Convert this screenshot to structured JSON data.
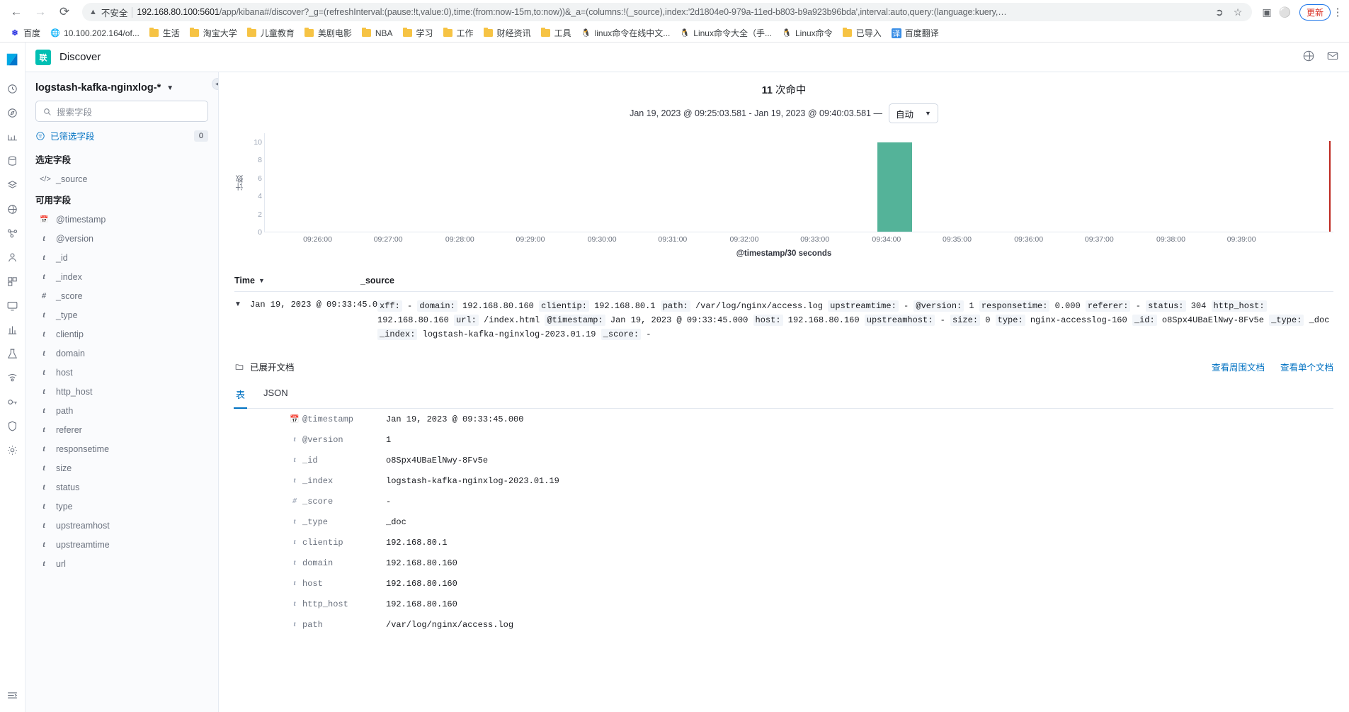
{
  "browser": {
    "back_icon": "back-arrow-icon",
    "forward_icon": "forward-arrow-icon",
    "reload_icon": "reload-icon",
    "not_secure_label": "不安全",
    "url_host": "192.168.80.100:5601",
    "url_rest": "/app/kibana#/discover?_g=(refreshInterval:(pause:!t,value:0),time:(from:now-15m,to:now))&_a=(columns:!(_source),index:'2d1804e0-979a-11ed-b803-b9a923b96bda',interval:auto,query:(language:kuery,…",
    "update_label": "更新",
    "bookmarks": [
      {
        "label": "百度",
        "icon": "baidu-icon"
      },
      {
        "label": "10.100.202.164/of...",
        "icon": "globe-icon"
      },
      {
        "label": "生活",
        "icon": "folder-icon"
      },
      {
        "label": "淘宝大学",
        "icon": "folder-icon"
      },
      {
        "label": "儿童教育",
        "icon": "folder-icon"
      },
      {
        "label": "美剧电影",
        "icon": "folder-icon"
      },
      {
        "label": "NBA",
        "icon": "folder-icon"
      },
      {
        "label": "学习",
        "icon": "folder-icon"
      },
      {
        "label": "工作",
        "icon": "folder-icon"
      },
      {
        "label": "财经资讯",
        "icon": "folder-icon"
      },
      {
        "label": "工具",
        "icon": "folder-icon"
      },
      {
        "label": "linux命令在线中文...",
        "icon": "tux-icon"
      },
      {
        "label": "Linux命令大全（手...",
        "icon": "tux-icon"
      },
      {
        "label": "Linux命令",
        "icon": "tux-icon"
      },
      {
        "label": "已导入",
        "icon": "folder-icon"
      },
      {
        "label": "百度翻译",
        "icon": "translate-icon"
      }
    ]
  },
  "kibana": {
    "app_badge": "联",
    "app_title": "Discover",
    "rail_items": [
      "clock-icon",
      "compass-icon",
      "chart-line-icon",
      "database-icon",
      "layers-icon",
      "pipeline-icon",
      "graph-icon",
      "user-icon",
      "apps-icon",
      "monitor-icon",
      "beaker-icon",
      "signal-icon",
      "key-icon",
      "shield-icon",
      "gear-icon"
    ],
    "header_right_icons": [
      "globe-help-icon",
      "mail-icon"
    ],
    "rail_bottom_icon": "collapse-rail-icon"
  },
  "sidebar": {
    "index_pattern": "logstash-kafka-nginxlog-*",
    "search_placeholder": "搜索字段",
    "filter_label": "已筛选字段",
    "filter_count": "0",
    "selected_title": "选定字段",
    "available_title": "可用字段",
    "selected_fields": [
      {
        "name": "_source",
        "type": "source"
      }
    ],
    "available_fields": [
      {
        "name": "@timestamp",
        "type": "date"
      },
      {
        "name": "@version",
        "type": "string"
      },
      {
        "name": "_id",
        "type": "string"
      },
      {
        "name": "_index",
        "type": "string"
      },
      {
        "name": "_score",
        "type": "number"
      },
      {
        "name": "_type",
        "type": "string"
      },
      {
        "name": "clientip",
        "type": "string"
      },
      {
        "name": "domain",
        "type": "string"
      },
      {
        "name": "host",
        "type": "string"
      },
      {
        "name": "http_host",
        "type": "string"
      },
      {
        "name": "path",
        "type": "string"
      },
      {
        "name": "referer",
        "type": "string"
      },
      {
        "name": "responsetime",
        "type": "string"
      },
      {
        "name": "size",
        "type": "string"
      },
      {
        "name": "status",
        "type": "string"
      },
      {
        "name": "type",
        "type": "string"
      },
      {
        "name": "upstreamhost",
        "type": "string"
      },
      {
        "name": "upstreamtime",
        "type": "string"
      },
      {
        "name": "url",
        "type": "string"
      }
    ]
  },
  "content": {
    "hits_count": "11",
    "hits_label": "次命中",
    "time_range": "Jan 19, 2023 @ 09:25:03.581 - Jan 19, 2023 @ 09:40:03.581 —",
    "interval_value": "自动",
    "table_header": {
      "time": "Time",
      "source": "_source"
    }
  },
  "chart_data": {
    "type": "bar",
    "title": "",
    "xlabel": "@timestamp/30 seconds",
    "ylabel": "计数",
    "ylim": [
      0,
      11
    ],
    "yticks": [
      0,
      2,
      4,
      6,
      8,
      10
    ],
    "xticks": [
      "09:26:00",
      "09:27:00",
      "09:28:00",
      "09:29:00",
      "09:30:00",
      "09:31:00",
      "09:32:00",
      "09:33:00",
      "09:34:00",
      "09:35:00",
      "09:36:00",
      "09:37:00",
      "09:38:00",
      "09:39:00"
    ],
    "grid": false,
    "legend": "none",
    "series": [
      {
        "name": "计数",
        "color": "#54b399",
        "points": [
          {
            "x": "09:33:30",
            "y": 11
          }
        ]
      }
    ],
    "marker": {
      "name": "time-marker",
      "x": "09:40:00",
      "color": "#bd271e"
    }
  },
  "document": {
    "timestamp": "Jan 19, 2023 @ 09:33:45.000",
    "source_pairs": [
      {
        "key": "xff:",
        "value": "-"
      },
      {
        "key": "domain:",
        "value": "192.168.80.160"
      },
      {
        "key": "clientip:",
        "value": "192.168.80.1"
      },
      {
        "key": "path:",
        "value": "/var/log/nginx/access.log"
      },
      {
        "key": "upstreamtime:",
        "value": "-"
      },
      {
        "key": "@version:",
        "value": "1"
      },
      {
        "key": "responsetime:",
        "value": "0.000"
      },
      {
        "key": "referer:",
        "value": "-"
      },
      {
        "key": "status:",
        "value": "304"
      },
      {
        "key": "http_host:",
        "value": "192.168.80.160"
      },
      {
        "key": "url:",
        "value": "/index.html"
      },
      {
        "key": "@timestamp:",
        "value": "Jan 19, 2023 @ 09:33:45.000"
      },
      {
        "key": "host:",
        "value": "192.168.80.160"
      },
      {
        "key": "upstreamhost:",
        "value": "-"
      },
      {
        "key": "size:",
        "value": "0"
      },
      {
        "key": "type:",
        "value": "nginx-accesslog-160"
      },
      {
        "key": "_id:",
        "value": "o8Spx4UBaElNwy-8Fv5e"
      },
      {
        "key": "_type:",
        "value": "_doc"
      },
      {
        "key": "_index:",
        "value": "logstash-kafka-nginxlog-2023.01.19"
      },
      {
        "key": "_score:",
        "value": "-"
      }
    ]
  },
  "expanded": {
    "title": "已展开文档",
    "link_surrounding": "查看周围文档",
    "link_single": "查看单个文档",
    "tabs": [
      {
        "label": "表",
        "active": true
      },
      {
        "label": "JSON",
        "active": false
      }
    ],
    "rows": [
      {
        "type": "date",
        "name": "@timestamp",
        "value": "Jan 19, 2023 @ 09:33:45.000"
      },
      {
        "type": "string",
        "name": "@version",
        "value": "1"
      },
      {
        "type": "string",
        "name": "_id",
        "value": "o8Spx4UBaElNwy-8Fv5e"
      },
      {
        "type": "string",
        "name": "_index",
        "value": "logstash-kafka-nginxlog-2023.01.19"
      },
      {
        "type": "number",
        "name": "_score",
        "value": "-"
      },
      {
        "type": "string",
        "name": "_type",
        "value": "_doc"
      },
      {
        "type": "string",
        "name": "clientip",
        "value": "192.168.80.1"
      },
      {
        "type": "string",
        "name": "domain",
        "value": "192.168.80.160"
      },
      {
        "type": "string",
        "name": "host",
        "value": "192.168.80.160"
      },
      {
        "type": "string",
        "name": "http_host",
        "value": "192.168.80.160"
      },
      {
        "type": "string",
        "name": "path",
        "value": "/var/log/nginx/access.log"
      }
    ]
  }
}
